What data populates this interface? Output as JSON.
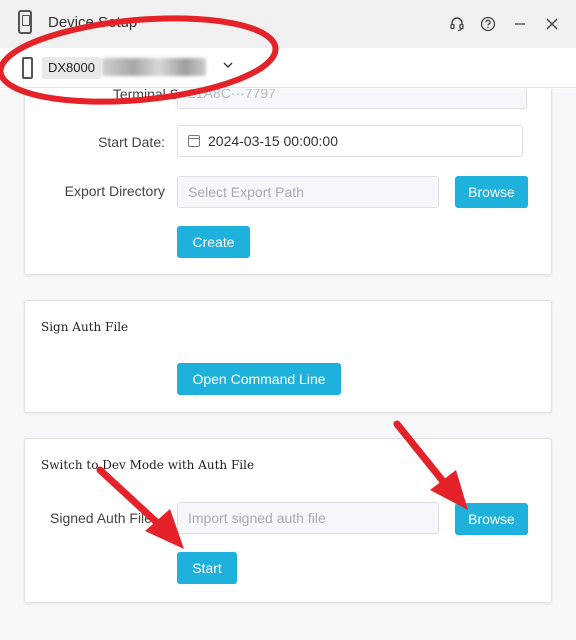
{
  "window": {
    "title": "Device Setup"
  },
  "device": {
    "model": "DX8000"
  },
  "terminal": {
    "label": "Terminal SN:",
    "value": "21A8C···7797"
  },
  "start_date": {
    "label": "Start Date:",
    "value": "2024-03-15 00:00:00"
  },
  "export": {
    "label": "Export Directory",
    "placeholder": "Select Export Path",
    "browse_label": "Browse",
    "create_label": "Create"
  },
  "sign_auth": {
    "title": "Sign Auth File",
    "button_label": "Open Command Line"
  },
  "dev_mode": {
    "title": "Switch to Dev Mode with Auth File",
    "label": "Signed Auth File",
    "placeholder": "Import signed auth file",
    "browse_label": "Browse",
    "start_label": "Start"
  },
  "colors": {
    "accent": "#1eb1db",
    "annotation": "#e5222a"
  }
}
